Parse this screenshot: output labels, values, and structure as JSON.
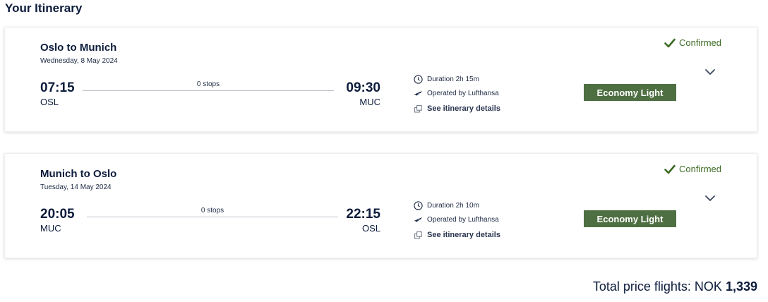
{
  "page": {
    "title": "Your Itinerary"
  },
  "flights": [
    {
      "route": "Oslo to Munich",
      "date": "Wednesday, 8 May 2024",
      "departure_time": "07:15",
      "departure_code": "OSL",
      "arrival_time": "09:30",
      "arrival_code": "MUC",
      "stops": "0 stops",
      "duration": "Duration 2h 15m",
      "operator": "Operated by Lufthansa",
      "details_link": "See itinerary details",
      "status": "Confirmed",
      "fare": "Economy Light"
    },
    {
      "route": "Munich to Oslo",
      "date": "Tuesday, 14 May 2024",
      "departure_time": "20:05",
      "departure_code": "MUC",
      "arrival_time": "22:15",
      "arrival_code": "OSL",
      "stops": "0 stops",
      "duration": "Duration 2h 10m",
      "operator": "Operated by Lufthansa",
      "details_link": "See itinerary details",
      "status": "Confirmed",
      "fare": "Economy Light"
    }
  ],
  "total": {
    "label": "Total price flights:",
    "currency": "NOK",
    "amount": "1,339"
  },
  "icons": {
    "status": "check-icon",
    "expand": "chevron-down-icon",
    "duration": "clock-icon",
    "operator": "airline-logo-icon",
    "details": "external-link-icon"
  },
  "colors": {
    "text": "#0c1c3c",
    "confirmed": "#3b6b22",
    "fare_badge": "#4e6f42"
  }
}
